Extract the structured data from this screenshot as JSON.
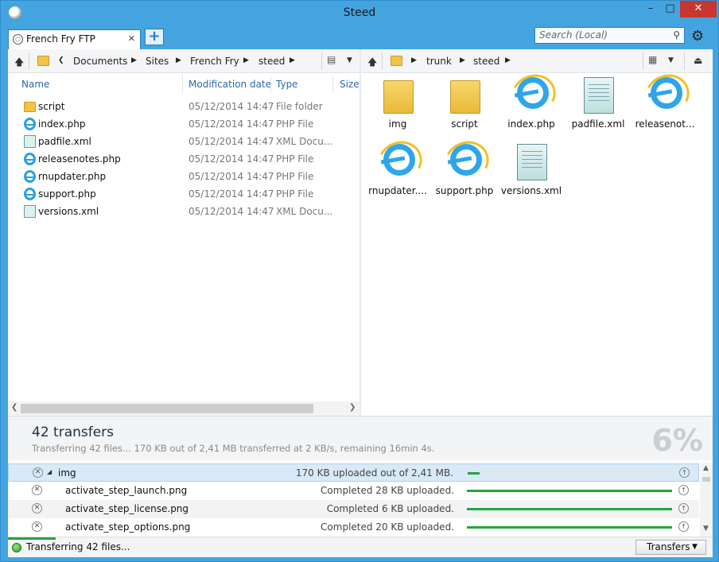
{
  "window": {
    "title": "Steed"
  },
  "tabs": {
    "active_label": "French Fry FTP",
    "add_label": "+"
  },
  "search": {
    "placeholder": "Search (Local)"
  },
  "left_pane": {
    "breadcrumb": [
      "Documents",
      "Sites",
      "French Fry",
      "steed"
    ],
    "columns": {
      "name": "Name",
      "modified": "Modification date",
      "type": "Type",
      "size": "Size"
    },
    "files": [
      {
        "name": "script",
        "date": "05/12/2014 14:47",
        "type": "File folder",
        "icon": "folder-icon"
      },
      {
        "name": "index.php",
        "date": "05/12/2014 14:47",
        "type": "PHP File",
        "icon": "ie-icon"
      },
      {
        "name": "padfile.xml",
        "date": "05/12/2014 14:47",
        "type": "XML Docu...",
        "icon": "xml-icon"
      },
      {
        "name": "releasenotes.php",
        "date": "05/12/2014 14:47",
        "type": "PHP File",
        "icon": "ie-icon"
      },
      {
        "name": "rnupdater.php",
        "date": "05/12/2014 14:47",
        "type": "PHP File",
        "icon": "ie-icon"
      },
      {
        "name": "support.php",
        "date": "05/12/2014 14:47",
        "type": "PHP File",
        "icon": "ie-icon"
      },
      {
        "name": "versions.xml",
        "date": "05/12/2014 14:47",
        "type": "XML Docu...",
        "icon": "xml-icon"
      }
    ]
  },
  "right_pane": {
    "breadcrumb": [
      "trunk",
      "steed"
    ],
    "items": [
      {
        "name": "img",
        "icon": "folder-icon"
      },
      {
        "name": "script",
        "icon": "folder-icon"
      },
      {
        "name": "index.php",
        "icon": "ie-icon"
      },
      {
        "name": "padfile.xml",
        "icon": "xml-icon"
      },
      {
        "name": "releasenot...",
        "icon": "ie-icon"
      },
      {
        "name": "rnupdater....",
        "icon": "ie-icon"
      },
      {
        "name": "support.php",
        "icon": "ie-icon"
      },
      {
        "name": "versions.xml",
        "icon": "xml-icon"
      }
    ]
  },
  "transfers": {
    "count_label": "42 transfers",
    "detail": "Transferring 42 files... 170 KB out of 2,41 MB transferred at 2 KB/s, remaining 16min 4s.",
    "percent_label": "6%",
    "rows": [
      {
        "name": "img",
        "status": "170 KB uploaded out of 2,41 MB.",
        "progress": 0.06
      },
      {
        "name": "activate_step_launch.png",
        "status": "Completed 28 KB uploaded.",
        "progress": 1.0
      },
      {
        "name": "activate_step_license.png",
        "status": "Completed 6 KB uploaded.",
        "progress": 1.0
      },
      {
        "name": "activate_step_options.png",
        "status": "Completed 20 KB uploaded.",
        "progress": 1.0
      }
    ]
  },
  "status": {
    "text": "Transferring 42 files...",
    "button_label": "Transfers"
  },
  "colors": {
    "accent": "#43a4e0",
    "progress": "#22a83a",
    "close": "#c7372f"
  }
}
